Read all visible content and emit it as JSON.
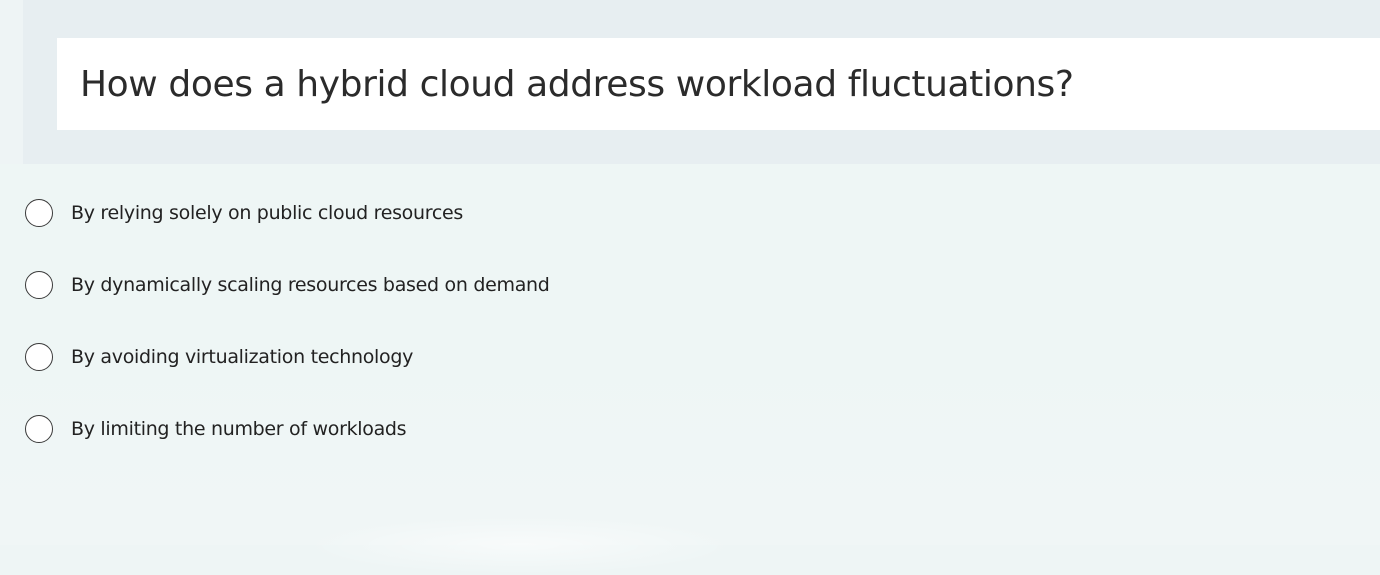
{
  "question": {
    "text": "How does a hybrid cloud address workload fluctuations?"
  },
  "options": [
    {
      "label": "By relying solely on public cloud resources",
      "selected": false
    },
    {
      "label": "By dynamically scaling resources based on demand",
      "selected": false
    },
    {
      "label": "By avoiding virtualization technology",
      "selected": false
    },
    {
      "label": "By limiting the number of workloads",
      "selected": false
    }
  ],
  "colors": {
    "page_background": "#eef5f5",
    "question_band": "#e7eef1",
    "question_card": "#ffffff",
    "text": "#222222",
    "radio_border": "#3a3a3a"
  }
}
